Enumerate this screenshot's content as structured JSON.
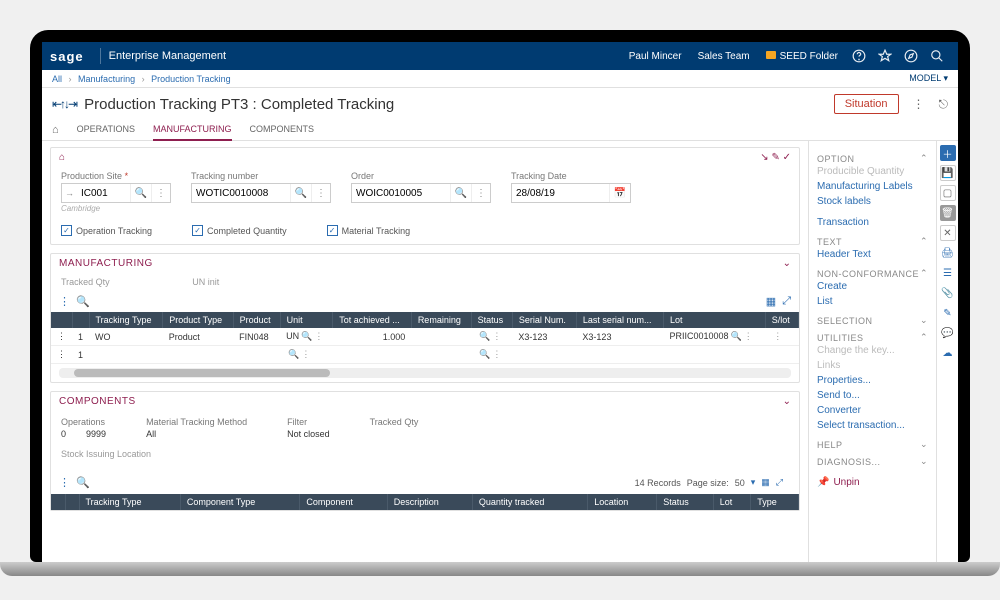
{
  "topbar": {
    "logo": "sage",
    "product": "Enterprise Management",
    "user": "Paul Mincer",
    "team": "Sales Team",
    "folder": "SEED Folder"
  },
  "breadcrumb": {
    "root": "All",
    "l1": "Manufacturing",
    "l2": "Production Tracking",
    "model": "MODEL"
  },
  "title": "Production Tracking PT3 : Completed Tracking",
  "situation_btn": "Situation",
  "tabs": {
    "operations": "OPERATIONS",
    "manufacturing": "MANUFACTURING",
    "components": "COMPONENTS"
  },
  "header_fields": {
    "prod_site_label": "Production Site",
    "prod_site_value": "IC001",
    "prod_site_hint": "Cambridge",
    "track_no_label": "Tracking number",
    "track_no_value": "WOTIC0010008",
    "order_label": "Order",
    "order_value": "WOIC0010005",
    "date_label": "Tracking Date",
    "date_value": "28/08/19"
  },
  "checks": {
    "op_tracking": "Operation Tracking",
    "completed_qty": "Completed Quantity",
    "material_tracking": "Material Tracking"
  },
  "mfg_panel": {
    "title": "MANUFACTURING",
    "tracked_qty_label": "Tracked Qty",
    "un_label": "UN  init",
    "cols": {
      "tracking_type": "Tracking Type",
      "product_type": "Product Type",
      "product": "Product",
      "unit": "Unit",
      "tot_achieved": "Tot achieved ...",
      "remaining": "Remaining",
      "status": "Status",
      "serial": "Serial Num.",
      "last_serial": "Last serial num...",
      "lot": "Lot",
      "slot": "S/lot"
    },
    "row": {
      "idx": "1",
      "tracking_type": "WO",
      "product_type": "Product",
      "product": "FIN048",
      "unit": "UN",
      "tot_achieved": "1.000",
      "serial": "X3-123",
      "last_serial": "X3-123",
      "lot": "PRIIC0010008"
    },
    "row2_idx": "1"
  },
  "comp_panel": {
    "title": "COMPONENTS",
    "operations_label": "Operations",
    "operations_from": "0",
    "operations_to": "9999",
    "method_label": "Material Tracking Method",
    "method_value": "All",
    "filter_label": "Filter",
    "filter_value": "Not closed",
    "tracked_qty_label": "Tracked Qty",
    "stock_loc_label": "Stock Issuing Location",
    "pager_records": "14 Records",
    "pager_size_label": "Page size:",
    "pager_size": "50",
    "cols": {
      "tracking_type": "Tracking Type",
      "component_type": "Component Type",
      "component": "Component",
      "description": "Description",
      "qty_tracked": "Quantity tracked",
      "location": "Location",
      "status": "Status",
      "lot": "Lot",
      "type": "Type"
    }
  },
  "right": {
    "option": "OPTION",
    "producible_qty": "Producible Quantity",
    "mfg_labels": "Manufacturing Labels",
    "stock_labels": "Stock labels",
    "transaction": "Transaction",
    "text": "TEXT",
    "header_text": "Header Text",
    "nonconf": "NON-CONFORMANCE",
    "create": "Create",
    "list": "List",
    "selection": "SELECTION",
    "utilities": "UTILITIES",
    "change_key": "Change the key...",
    "links": "Links",
    "properties": "Properties...",
    "send_to": "Send to...",
    "converter": "Converter",
    "select_trans": "Select transaction...",
    "help": "HELP",
    "diagnosis": "DIAGNOSIS...",
    "unpin": "Unpin"
  }
}
